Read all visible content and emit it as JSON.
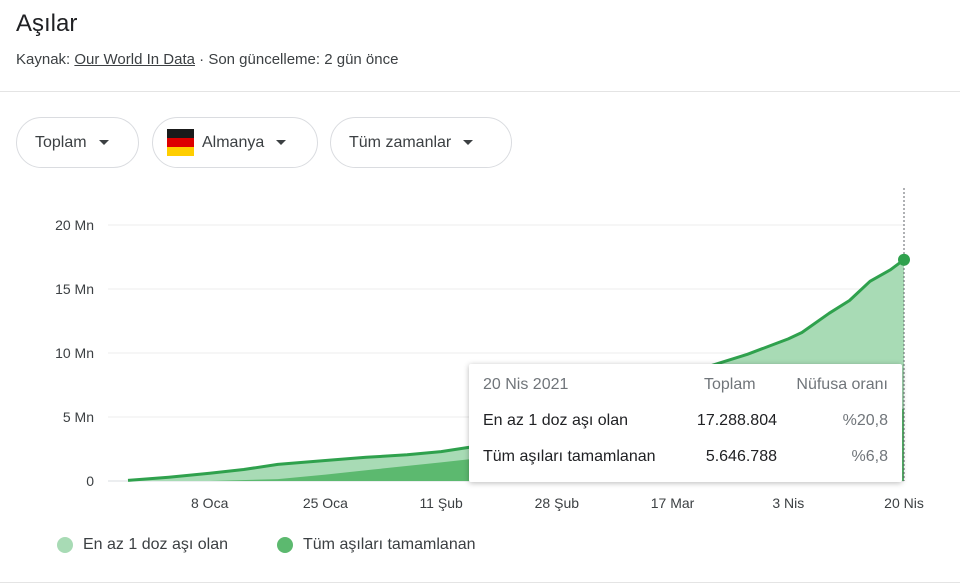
{
  "header": {
    "title": "Aşılar",
    "source_label": "Kaynak:",
    "source_link": "Our World In Data",
    "updated": " · Son güncelleme: 2 gün önce"
  },
  "filters": {
    "metric": "Toplam",
    "country": "Almanya",
    "range": "Tüm zamanlar"
  },
  "colors": {
    "first_dose_fill": "#a8dbb5",
    "fully_vaccinated_fill": "#5cb96f",
    "line": "#2fa14d"
  },
  "chart_data": {
    "type": "area",
    "ytick_labels": [
      "0",
      "5 Mn",
      "10 Mn",
      "15 Mn",
      "20 Mn"
    ],
    "yticks": [
      0,
      5000000,
      10000000,
      15000000,
      20000000
    ],
    "ylim": [
      0,
      20000000
    ],
    "xtick_labels": [
      "8 Oca",
      "25 Oca",
      "11 Şub",
      "28 Şub",
      "17 Mar",
      "3 Nis",
      "20 Nis"
    ],
    "xticks": [
      "2021-01-08",
      "2021-01-25",
      "2021-02-11",
      "2021-02-28",
      "2021-03-17",
      "2021-04-03",
      "2021-04-20"
    ],
    "xlim": [
      "2020-12-27",
      "2021-04-20"
    ],
    "grid": true,
    "legend_position": "bottom",
    "series": [
      {
        "name": "En az 1 doz aşı olan",
        "x": [
          "2020-12-27",
          "2021-01-02",
          "2021-01-08",
          "2021-01-13",
          "2021-01-18",
          "2021-01-25",
          "2021-01-31",
          "2021-02-06",
          "2021-02-11",
          "2021-02-16",
          "2021-02-22",
          "2021-02-28",
          "2021-03-05",
          "2021-03-10",
          "2021-03-17",
          "2021-03-22",
          "2021-03-28",
          "2021-04-01",
          "2021-04-03",
          "2021-04-05",
          "2021-04-09",
          "2021-04-12",
          "2021-04-15",
          "2021-04-18",
          "2021-04-20"
        ],
        "values": [
          50000,
          300000,
          600000,
          900000,
          1300000,
          1600000,
          1850000,
          2050000,
          2300000,
          2700000,
          3200000,
          3900000,
          4700000,
          6000000,
          7800000,
          8900000,
          9900000,
          10700000,
          11100000,
          11600000,
          13100000,
          14100000,
          15600000,
          16500000,
          17288804
        ]
      },
      {
        "name": "Tüm aşıları tamamlanan",
        "x": [
          "2020-12-27",
          "2021-01-08",
          "2021-01-18",
          "2021-01-25",
          "2021-02-01",
          "2021-02-11",
          "2021-02-22",
          "2021-02-28",
          "2021-03-10",
          "2021-03-17",
          "2021-03-28",
          "2021-04-03",
          "2021-04-10",
          "2021-04-20"
        ],
        "values": [
          0,
          0,
          150000,
          500000,
          900000,
          1450000,
          2100000,
          2650000,
          3100000,
          3400000,
          4000000,
          4400000,
          5000000,
          5646788
        ]
      }
    ]
  },
  "tooltip": {
    "date": "20 Nis 2021",
    "col_total": "Toplam",
    "col_pct": "Nüfusa oranı",
    "rows": [
      {
        "label": "En az 1 doz aşı olan",
        "total": "17.288.804",
        "pct": "%20,8"
      },
      {
        "label": "Tüm aşıları tamamlanan",
        "total": "5.646.788",
        "pct": "%6,8"
      }
    ]
  },
  "legend": {
    "first_dose": "En az 1 doz aşı olan",
    "fully_vaccinated": "Tüm aşıları tamamlanan"
  }
}
